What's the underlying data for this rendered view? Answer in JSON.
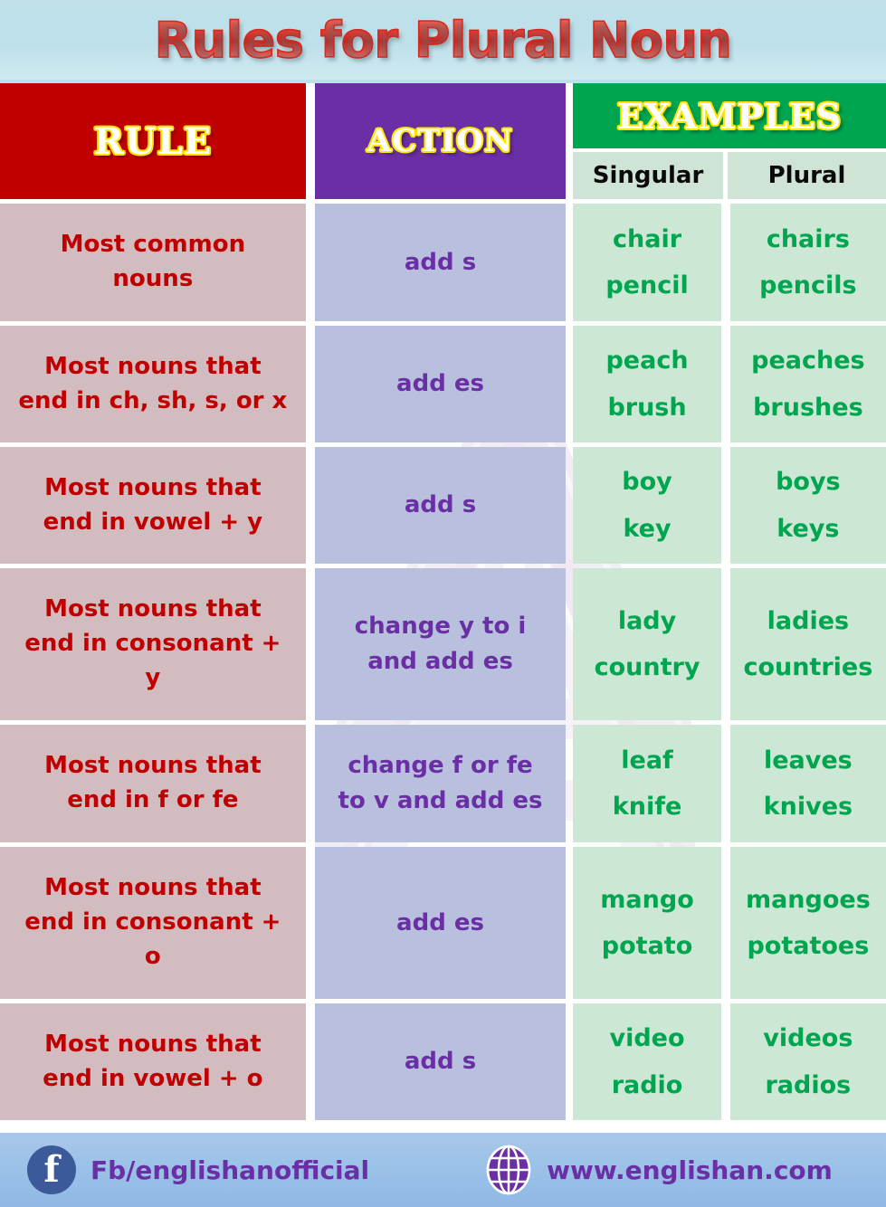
{
  "title": "Rules for Plural Noun",
  "colors": {
    "title_red": "#d12a20",
    "header_rule_bg": "#c00000",
    "header_action_bg": "#6b2fa5",
    "header_examples_bg": "#00a550",
    "rule_cell_bg": "#d3bcc0",
    "action_cell_bg": "#b9c0de",
    "example_cell_bg": "#cce8d4",
    "rule_text": "#c00000",
    "action_text": "#6b2fa5",
    "example_text": "#00a550",
    "page_bg": "#bfe0ea",
    "footer_bg": "#9dc2e8"
  },
  "headers": {
    "rule": "RULE",
    "action": "ACTION",
    "examples": "EXAMPLES",
    "singular": "Singular",
    "plural": "Plural"
  },
  "rows": [
    {
      "rule": [
        "Most common",
        "nouns"
      ],
      "action": [
        "add s"
      ],
      "singular": [
        "chair",
        "pencil"
      ],
      "plural": [
        "chairs",
        "pencils"
      ]
    },
    {
      "rule": [
        "Most nouns that",
        "end in ch, sh, s, or x"
      ],
      "action": [
        "add es"
      ],
      "singular": [
        "peach",
        "brush"
      ],
      "plural": [
        "peaches",
        "brushes"
      ]
    },
    {
      "rule": [
        "Most nouns that",
        "end in vowel + y"
      ],
      "action": [
        "add s"
      ],
      "singular": [
        "boy",
        "key"
      ],
      "plural": [
        "boys",
        "keys"
      ]
    },
    {
      "rule": [
        "Most nouns that",
        "end in consonant +",
        "y"
      ],
      "action": [
        "change y to i",
        "and add es"
      ],
      "singular": [
        "lady",
        "country"
      ],
      "plural": [
        "ladies",
        "countries"
      ]
    },
    {
      "rule": [
        "Most nouns that",
        "end in f or fe"
      ],
      "action": [
        "change f or fe",
        "to v and add es"
      ],
      "singular": [
        "leaf",
        "knife"
      ],
      "plural": [
        "leaves",
        "knives"
      ]
    },
    {
      "rule": [
        "Most nouns that",
        "end in consonant +",
        "o"
      ],
      "action": [
        "add es"
      ],
      "singular": [
        "mango",
        "potato"
      ],
      "plural": [
        "mangoes",
        "potatoes"
      ]
    },
    {
      "rule": [
        "Most nouns that",
        "end in vowel + o"
      ],
      "action": [
        "add s"
      ],
      "singular": [
        "video",
        "radio"
      ],
      "plural": [
        "videos",
        "radios"
      ]
    }
  ],
  "footer": {
    "facebook_glyph": "f",
    "facebook_label": "Fb/englishanofficial",
    "website_label": "www.englishan.com"
  }
}
